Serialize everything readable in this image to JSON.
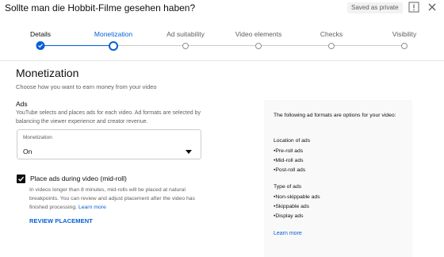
{
  "header": {
    "title": "Sollte man die Hobbit-Filme gesehen haben?",
    "status_badge": "Saved as private"
  },
  "stepper": {
    "steps": [
      {
        "label": "Details",
        "state": "done"
      },
      {
        "label": "Monetization",
        "state": "active"
      },
      {
        "label": "Ad suitability",
        "state": "todo"
      },
      {
        "label": "Video elements",
        "state": "todo"
      },
      {
        "label": "Checks",
        "state": "todo"
      },
      {
        "label": "Visibility",
        "state": "todo"
      }
    ]
  },
  "main": {
    "title": "Monetization",
    "subtitle": "Choose how you want to earn money from your video",
    "ads_heading": "Ads",
    "ads_description": "YouTube selects and places ads for each video. Ad formats are selected by balancing the viewer experience and creator revenue.",
    "monetization_select": {
      "label": "Monetization",
      "value": "On"
    },
    "midroll_checkbox": {
      "label": "Place ads during video (mid-roll)",
      "checked": true,
      "description": "In videos longer than 8 minutes, mid-rolls will be placed at natural breakpoints. You can review and adjust placement after the video has finished processing.",
      "learn_more": "Learn more"
    },
    "review_placement": "REVIEW PLACEMENT"
  },
  "info_panel": {
    "intro": "The following ad formats are options for your video:",
    "location_heading": "Location of ads",
    "location_items": [
      "•Pre-roll ads",
      "•Mid-roll ads",
      "•Post-roll ads"
    ],
    "type_heading": "Type of ads",
    "type_items": [
      "•Non-skippable ads",
      "•Skippable ads",
      "•Display ads"
    ],
    "learn_more": "Learn more"
  },
  "colors": {
    "accent": "#065fd4",
    "text": "#0f0f0f",
    "secondary_text": "#606060",
    "panel_bg": "#f9f9f9"
  },
  "icons": {
    "flag": "flag-icon",
    "close": "close-icon",
    "caret": "caret-down-icon",
    "check": "check-icon"
  }
}
